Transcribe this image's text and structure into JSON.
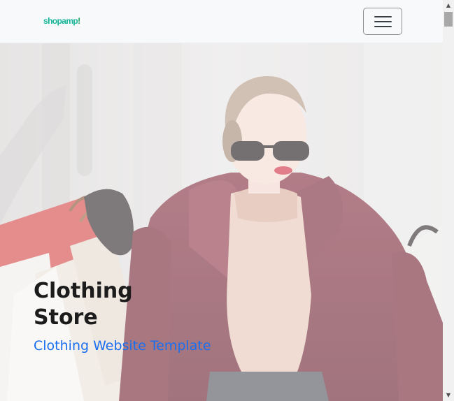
{
  "navbar": {
    "brand_main": "shopamp",
    "brand_accent": "!",
    "toggler_icon": "hamburger-menu-icon"
  },
  "hero": {
    "title": "Clothing Store",
    "subtitle": "Clothing Website Template",
    "image_description_icon": "woman-with-shopping-bags-photo"
  },
  "colors": {
    "brand": "#14b39a",
    "navbar_bg": "#f8f9fa",
    "subtitle": "#1a6ff0",
    "title": "#1c1c1c"
  },
  "scrollbar": {
    "up_icon": "scroll-up-arrow-icon",
    "down_icon": "scroll-down-arrow-icon"
  }
}
